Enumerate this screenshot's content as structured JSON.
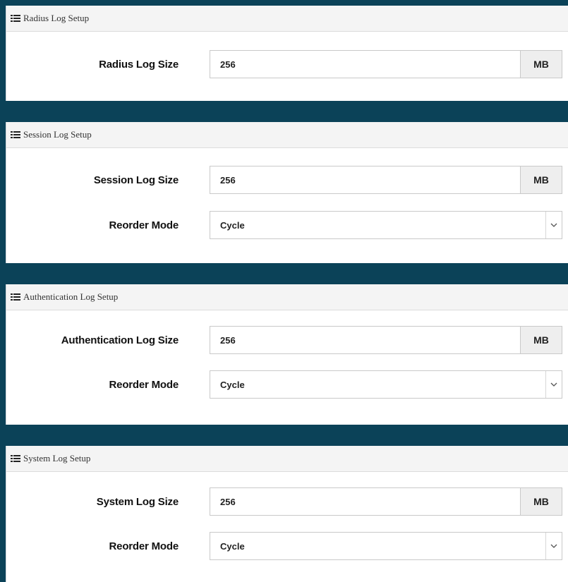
{
  "sections": [
    {
      "header": "Radius Log Setup",
      "size_label": "Radius Log Size",
      "size_value": "256",
      "size_unit": "MB"
    },
    {
      "header": "Session Log Setup",
      "size_label": "Session Log Size",
      "size_value": "256",
      "size_unit": "MB",
      "mode_label": "Reorder Mode",
      "mode_value": "Cycle"
    },
    {
      "header": "Authentication Log Setup",
      "size_label": "Authentication Log Size",
      "size_value": "256",
      "size_unit": "MB",
      "mode_label": "Reorder Mode",
      "mode_value": "Cycle"
    },
    {
      "header": "System Log Setup",
      "size_label": "System Log Size",
      "size_value": "256",
      "size_unit": "MB",
      "mode_label": "Reorder Mode",
      "mode_value": "Cycle"
    }
  ],
  "colors": {
    "page_background": "#0b4258",
    "panel_header_background": "#f4f4f4",
    "addon_background": "#eeeeee"
  },
  "icons": {
    "section_header_icon": "list-icon",
    "select_icon": "chevron-down-icon"
  }
}
